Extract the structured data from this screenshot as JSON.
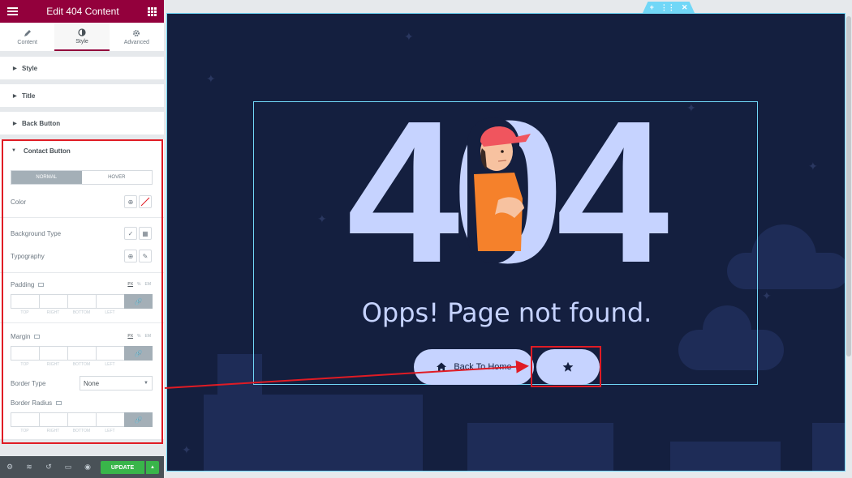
{
  "panel": {
    "title": "Edit 404 Content",
    "tabs": [
      {
        "label": "Content",
        "icon": "pencil-icon"
      },
      {
        "label": "Style",
        "icon": "half-circle-icon"
      },
      {
        "label": "Advanced",
        "icon": "gear-icon"
      }
    ],
    "sections": [
      "Style",
      "Title",
      "Back Button"
    ],
    "contact": {
      "heading": "Contact Button",
      "states": [
        "NORMAL",
        "HOVER"
      ],
      "color_label": "Color",
      "bg_type_label": "Background Type",
      "typography_label": "Typography",
      "padding_label": "Padding",
      "margin_label": "Margin",
      "units": [
        "PX",
        "%",
        "EM"
      ],
      "dim_labels": [
        "TOP",
        "RIGHT",
        "BOTTOM",
        "LEFT"
      ],
      "border_type_label": "Border Type",
      "border_type_value": "None",
      "border_radius_label": "Border Radius"
    },
    "footer": {
      "update_label": "UPDATE"
    }
  },
  "preview": {
    "big_text": "404",
    "message": "Opps! Page not found.",
    "home_button": "Back To Home"
  },
  "colors": {
    "brand": "#93003c",
    "stage": "#141f3f",
    "accent": "#c6d3ff",
    "highlight": "#e01b24",
    "update": "#39b54a"
  }
}
